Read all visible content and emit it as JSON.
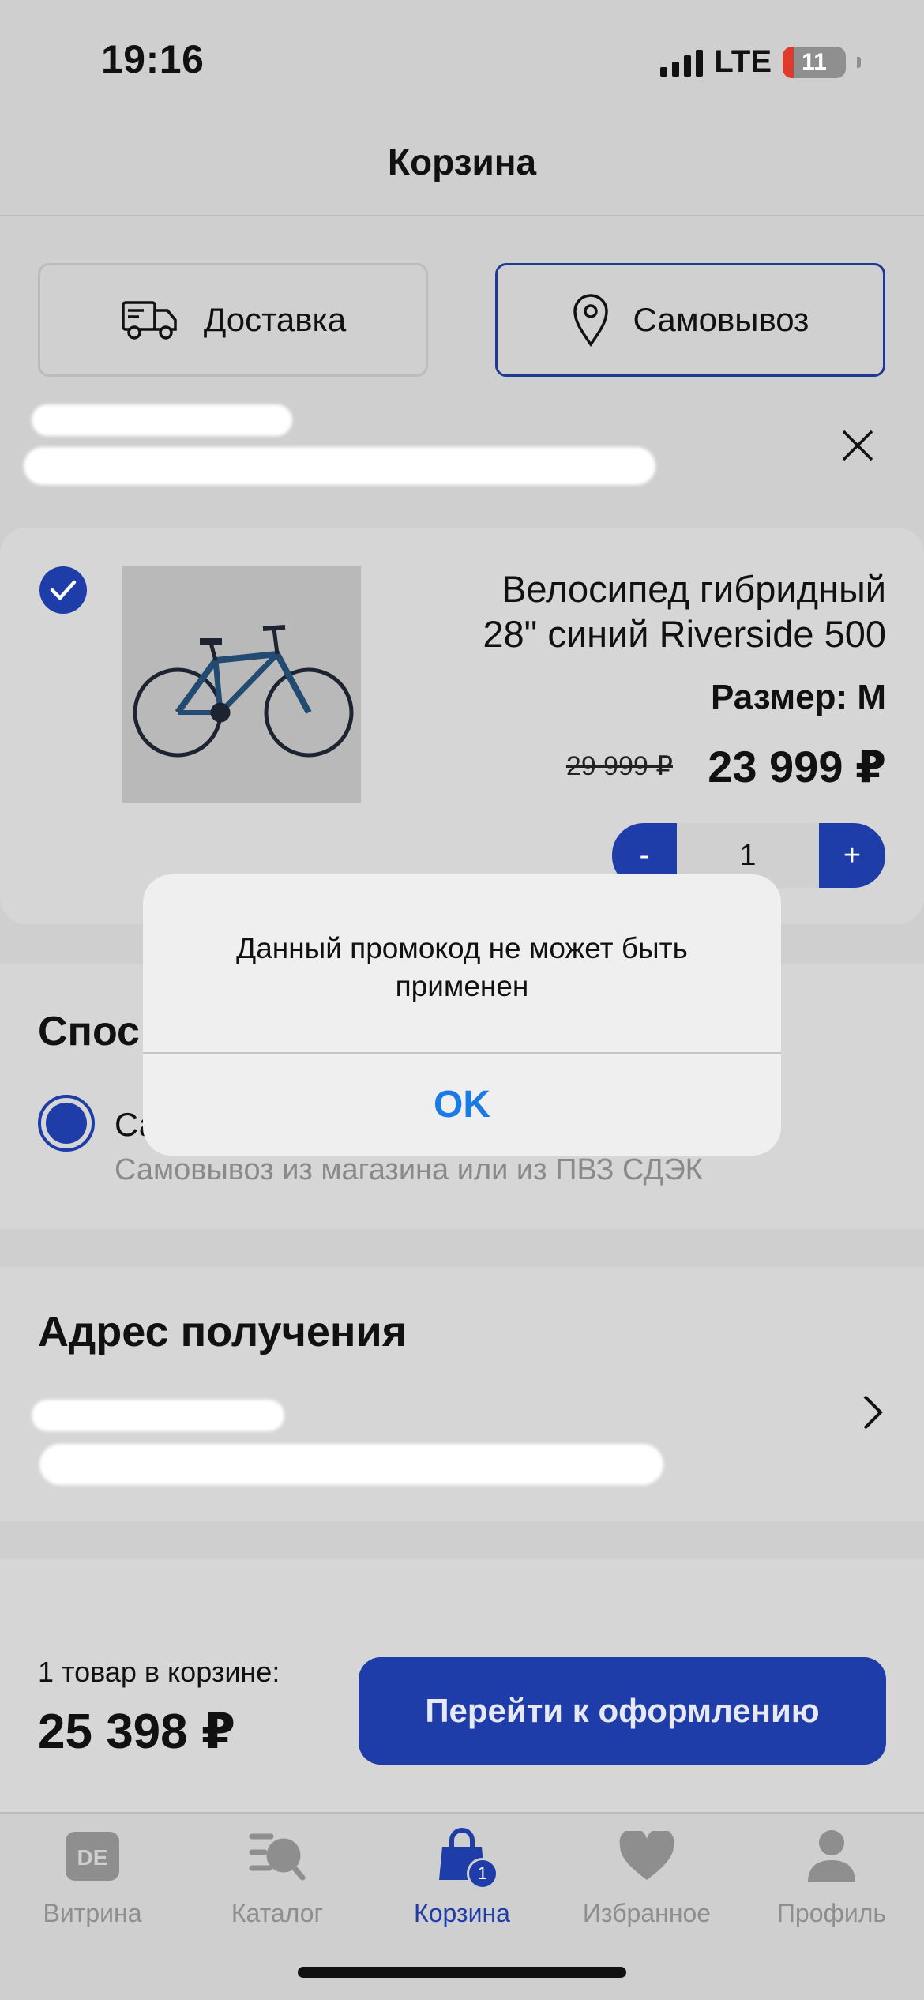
{
  "status_bar": {
    "time": "19:16",
    "network": "LTE",
    "battery": "11"
  },
  "header": {
    "title": "Корзина"
  },
  "delivery_toggle": {
    "delivery_label": "Доставка",
    "pickup_label": "Самовывоз"
  },
  "product": {
    "title_line1": "Велосипед гибридный",
    "title_line2": "28\" синий Riverside 500",
    "size": "Размер: M",
    "old_price": "29 999 ₽",
    "price": "23 999 ₽",
    "quantity": "1",
    "minus_label": "-",
    "plus_label": "+",
    "selected": true
  },
  "shipping": {
    "title": "Спос",
    "option_label": "Са",
    "option_description": "Самовывоз из магазина или из ПВЗ СДЭК"
  },
  "address": {
    "title": "Адрес получения"
  },
  "summary": {
    "count_text": "1 товар в корзине:",
    "total": "25 398 ₽",
    "checkout_label": "Перейти к оформлению"
  },
  "tabs": [
    {
      "label": "Витрина",
      "icon": "storefront-icon"
    },
    {
      "label": "Каталог",
      "icon": "catalog-search-icon"
    },
    {
      "label": "Корзина",
      "icon": "cart-bag-icon",
      "badge": "1",
      "active": true
    },
    {
      "label": "Избранное",
      "icon": "heart-icon"
    },
    {
      "label": "Профиль",
      "icon": "profile-icon"
    }
  ],
  "alert": {
    "message": "Данный промокод не может быть применен",
    "ok_label": "OK"
  },
  "colors": {
    "accent": "#1f3da8",
    "alert_button": "#1a7ae6",
    "background": "#cfcfcf"
  }
}
